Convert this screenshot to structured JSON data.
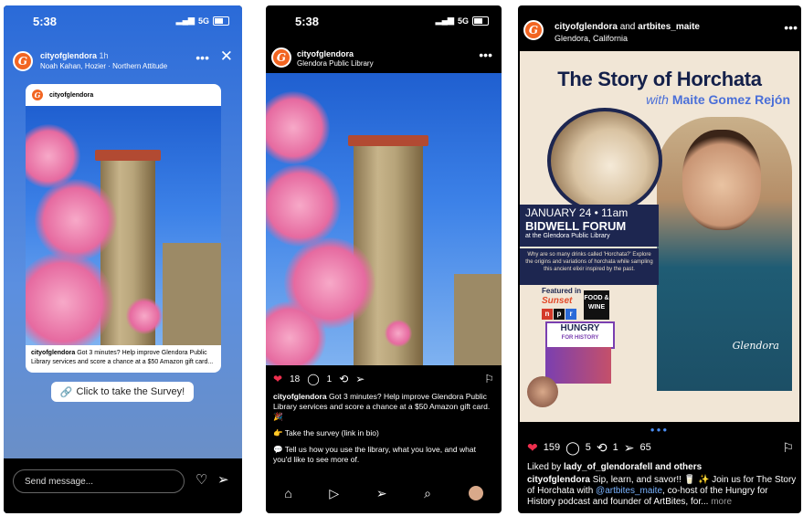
{
  "status_p1": {
    "time": "5:38",
    "network": "5G"
  },
  "status_p2": {
    "time": "5:38",
    "network": "5G"
  },
  "story": {
    "username": "cityofglendora",
    "age": "1h",
    "music": "Noah Kahan, Hozier · Northern Attitude",
    "card_username": "cityofglendora",
    "card_caption_user": "cityofglendora",
    "card_caption": "Got 3 minutes? Help improve Glendora Public Library services and score a chance at a $50 Amazon gift card...",
    "survey_label": "Click to take the Survey!",
    "send_placeholder": "Send message..."
  },
  "post2": {
    "username": "cityofglendora",
    "location": "Glendora Public Library",
    "likes": "18",
    "comments": "1",
    "caption_user": "cityofglendora",
    "caption_1": "Got 3 minutes? Help improve Glendora Public Library services and score a chance at a $50 Amazon gift card. 🎉",
    "caption_2": "👉 Take the survey (link in bio)",
    "caption_3": "💬 Tell us how you use the library, what you love, and what you'd like to see more of."
  },
  "post3": {
    "username": "cityofglendora",
    "and_text": "and",
    "collab": "artbites_maite",
    "location": "Glendora, California",
    "poster_title": "The Story of Horchata",
    "poster_sub_with": "with",
    "poster_sub_name": "Maite Gomez Rejón",
    "date": "JANUARY 24 • 11am",
    "venue": "BIDWELL FORUM",
    "venue_sub": "at the Glendora Public Library",
    "why": "Why are so many drinks called 'Horchata?' Explore the origins and variations of horchata while sampling this ancient elixir inspired by the past.",
    "featured_label": "Featured in",
    "sunset": "Sunset",
    "food_wine": "FOOD & WINE",
    "hungry": "HUNGRY",
    "hungry_sub": "FOR HISTORY",
    "signature": "Glendora",
    "likes": "159",
    "comments": "5",
    "reposts": "1",
    "shares": "65",
    "liked_by_prefix": "Liked by",
    "liked_by_user": "lady_of_glendorafell",
    "liked_by_suffix": "and others",
    "caption_user": "cityofglendora",
    "caption_a": "Sip, learn, and savor!! 🥛 ✨ Join us for The Story of Horchata with",
    "caption_mention": "@artbites_maite",
    "caption_b": ", co-host of the Hungry for History podcast and founder of ArtBites, for...",
    "more": "more"
  },
  "colors": {
    "brand": "#f26522",
    "poster_navy": "#1d2650",
    "like_red": "#ed2f4e",
    "mention_blue": "#7ab3ff"
  },
  "icons": {
    "heart": "heart-icon",
    "comment": "comment-icon",
    "repost": "repost-icon",
    "share": "share-icon",
    "bookmark": "bookmark-icon",
    "home": "home-icon",
    "reels": "reels-icon",
    "search": "search-icon",
    "close": "close-icon"
  }
}
